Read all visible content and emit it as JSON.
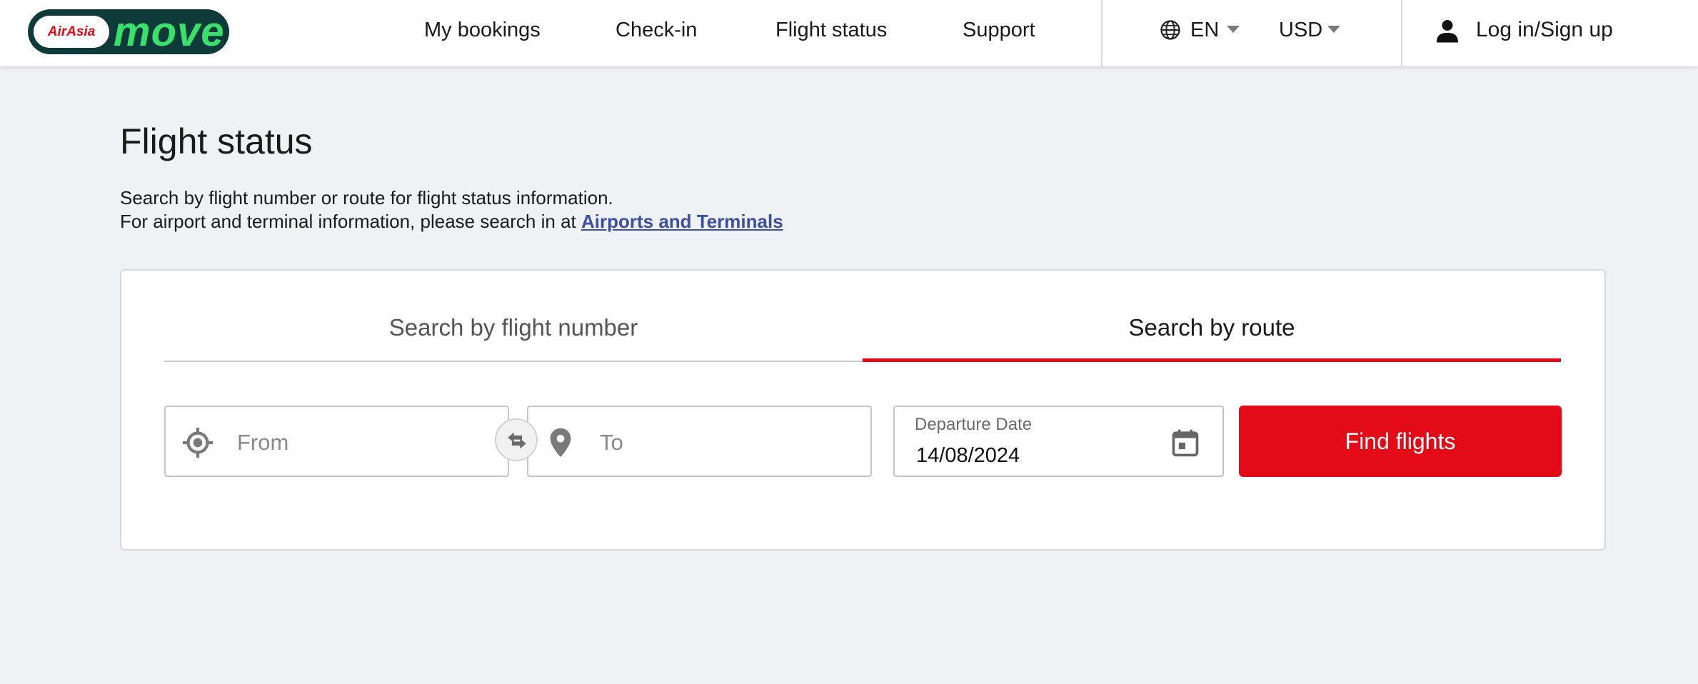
{
  "header": {
    "logo": {
      "badge": "AirAsia",
      "word": "move"
    },
    "nav": [
      {
        "label": "My bookings"
      },
      {
        "label": "Check-in"
      },
      {
        "label": "Flight status"
      },
      {
        "label": "Support"
      }
    ],
    "language": "EN",
    "currency": "USD",
    "login_label": "Log in/Sign up"
  },
  "main": {
    "title": "Flight status",
    "description_line1": "Search by flight number or route for flight status information.",
    "description_line2": "For airport and terminal information, please search in at ",
    "airports_link": "Airports and Terminals",
    "tabs": [
      {
        "label": "Search by flight number",
        "active": false
      },
      {
        "label": "Search by route",
        "active": true
      }
    ],
    "from_placeholder": "From",
    "to_placeholder": "To",
    "departure_date_label": "Departure Date",
    "departure_date_value": "14/08/2024",
    "find_button": "Find flights"
  },
  "colors": {
    "accent": "#e30b17",
    "link": "#3d4fa0",
    "background": "#f0f1f5",
    "logo_bg": "#0e3a3a",
    "logo_word": "#39e06b"
  },
  "icons": [
    "globe-icon",
    "caret-down-icon",
    "user-icon",
    "crosshair-icon",
    "location-pin-icon",
    "swap-icon",
    "calendar-icon"
  ]
}
